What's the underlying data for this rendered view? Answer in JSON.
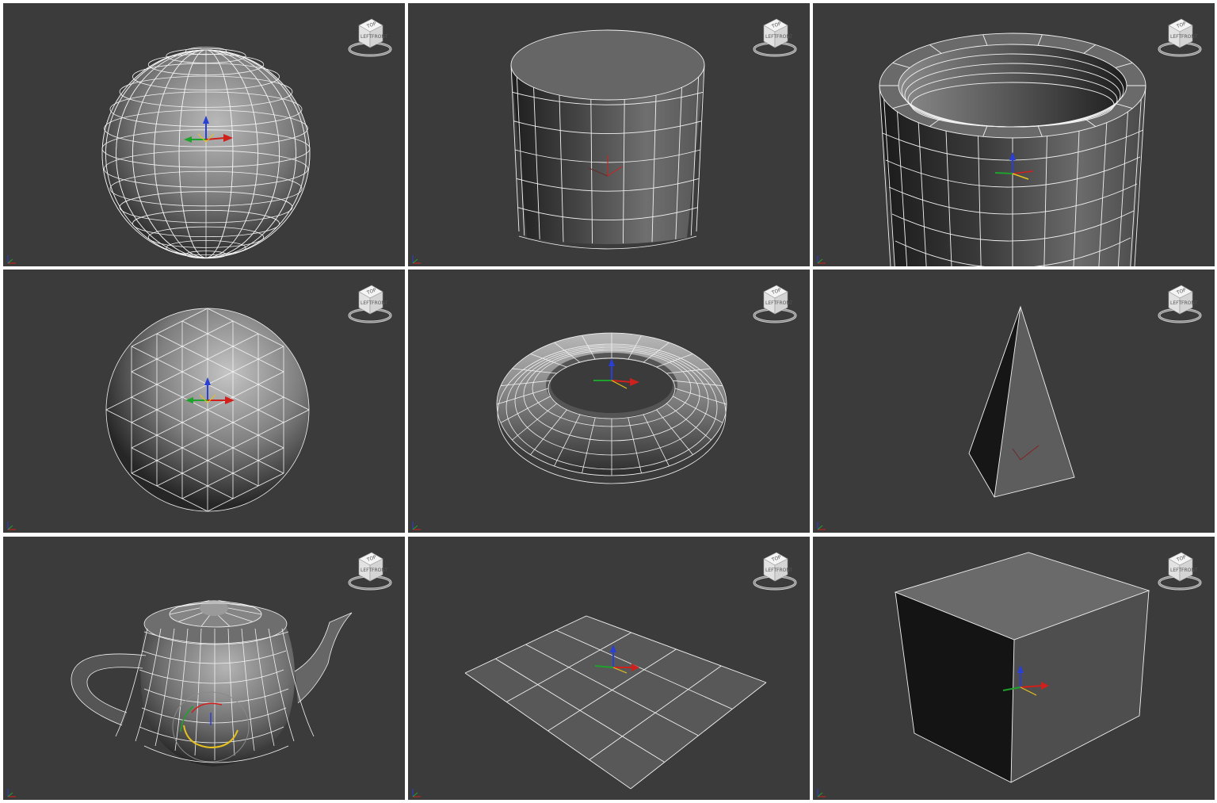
{
  "viewcube": {
    "top_label": "TOP",
    "left_label": "LEFT",
    "front_label": "FRONT"
  },
  "colors": {
    "viewport_bg": "#3b3b3b",
    "wire": "#f2f2f2",
    "axis_x": "#d0201c",
    "axis_y": "#1fa22b",
    "axis_z": "#2a3fd6",
    "gizmo_yellow": "#e6c21e"
  },
  "viewports": [
    {
      "id": "sphere",
      "object": "sphere-mesh",
      "gizmo": "move-gizmo"
    },
    {
      "id": "cylinder",
      "object": "cylinder-mesh",
      "gizmo": "pivot-gizmo"
    },
    {
      "id": "tube",
      "object": "tube-mesh",
      "gizmo": "move-gizmo"
    },
    {
      "id": "geosphere",
      "object": "geosphere-mesh",
      "gizmo": "move-gizmo"
    },
    {
      "id": "torus",
      "object": "torus-mesh",
      "gizmo": "move-gizmo"
    },
    {
      "id": "pyramid",
      "object": "pyramid-mesh",
      "gizmo": "pivot-gizmo"
    },
    {
      "id": "teapot",
      "object": "teapot-mesh",
      "gizmo": "rotate-gizmo"
    },
    {
      "id": "plane",
      "object": "plane-mesh",
      "gizmo": "move-gizmo"
    },
    {
      "id": "box",
      "object": "box-mesh",
      "gizmo": "move-gizmo"
    }
  ]
}
